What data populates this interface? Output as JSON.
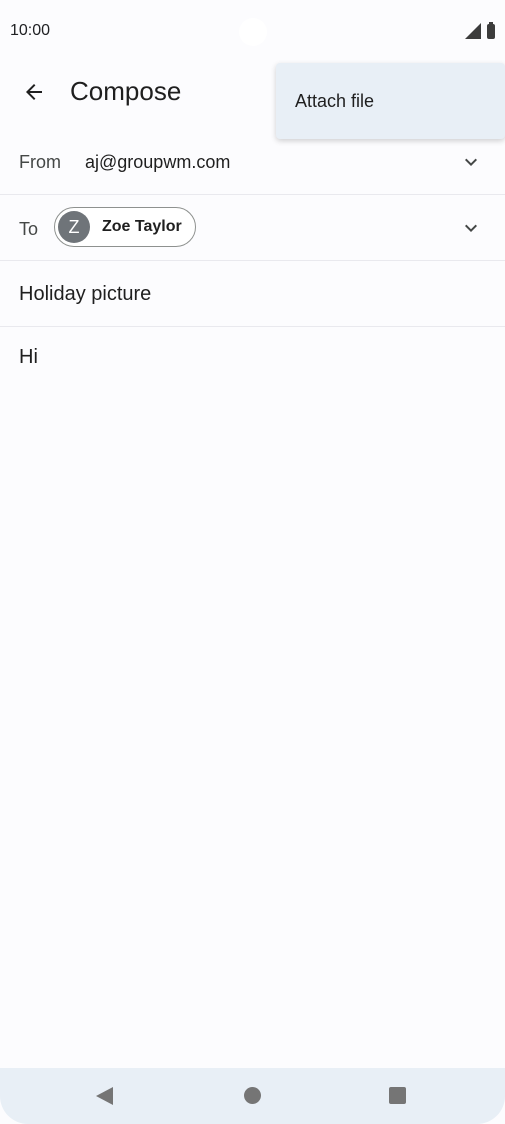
{
  "status_bar": {
    "time": "10:00"
  },
  "app_bar": {
    "title": "Compose"
  },
  "menu": {
    "items": [
      {
        "label": "Attach file"
      }
    ]
  },
  "from": {
    "label": "From",
    "value": "aj@groupwm.com"
  },
  "to": {
    "label": "To",
    "recipient": {
      "initial": "Z",
      "name": "Zoe Taylor"
    }
  },
  "subject": {
    "value": "Holiday picture"
  },
  "body": {
    "value": "Hi"
  },
  "colors": {
    "background": "#fcfcfe",
    "menu_surface": "#e8eff6",
    "avatar": "#6f7479"
  }
}
